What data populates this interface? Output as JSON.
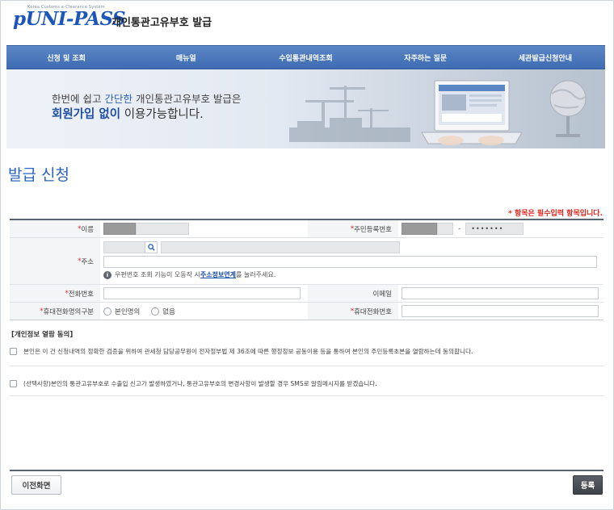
{
  "header": {
    "logo_small": "Korea Customs e-Clearance System",
    "logo_text": "UNI-PASS",
    "title": "개인통관고유부호 발급"
  },
  "nav": {
    "items": [
      "신청 및 조회",
      "매뉴얼",
      "수입통관내역조회",
      "자주하는 질문",
      "세관발급신청안내"
    ]
  },
  "banner": {
    "line1_pre": "한번에 쉽고 ",
    "line1_hl": "간단한",
    "line1_post": " 개인통관고유부호 발급은",
    "line2_hl": "회원가입 없이",
    "line2_post": " 이용가능합니다."
  },
  "page": {
    "heading": "발급 신청",
    "required_note": "* 항목은 필수입력 항목입니다."
  },
  "form": {
    "name_label": "이름",
    "rrn_label": "주민등록번호",
    "rrn_dash": "-",
    "rrn_masked": "•••••••",
    "address_label": "주소",
    "address_hint_pre": "우편번호 조회 기능이 오동작 시 ",
    "address_hint_link": "주소정보연계",
    "address_hint_post": "를 눌러주세요.",
    "phone_label": "전화번호",
    "email_label": "이메일",
    "mobile_type_label": "휴대전화명의구분",
    "mobile_type_options": [
      "본인명의",
      "없음"
    ],
    "mobile_label": "휴대전화번호",
    "required_mark": "*"
  },
  "consent": {
    "title": "[개인정보 열람 동의]",
    "items": [
      "본인은 이 건 신청내역의 정확한 검증을 위하여 관세청 담당공무원이 전자정부법 제 36조에 따른 행정정보 공동이용 등을 통하여 본인의 주민등록초본을 열람하는데 동의합니다.",
      "(선택사항)본인의 통관고유부호로 수출입 신고가 발생하였거나, 통관고유부호의 변경사항이 발생할 경우 SMS로 알림메시지를 받겠습니다."
    ]
  },
  "buttons": {
    "prev": "이전화면",
    "submit": "등록"
  },
  "colors": {
    "nav": "#4874b8",
    "accent": "#2a63bf",
    "required": "#e0251b"
  }
}
